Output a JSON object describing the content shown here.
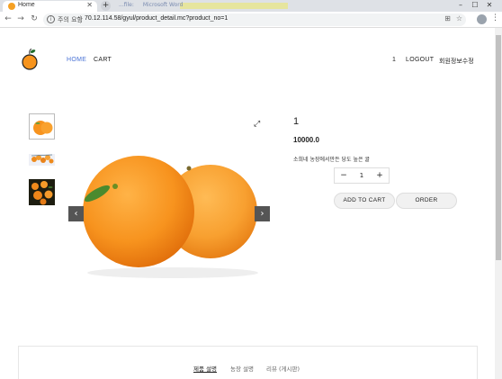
{
  "browser": {
    "tab_title": "Home",
    "blurred_tabs": [
      "...file:",
      "Microsoft Word"
    ],
    "security_label": "주의 요함",
    "url": "70.12.114.58/gyul/product_detail.mc?product_no=1"
  },
  "header": {
    "nav": [
      {
        "label": "HOME",
        "active": true
      },
      {
        "label": "CART",
        "active": false
      }
    ],
    "cart_count": "1",
    "logout_label": "LOGOUT",
    "member_edit_label": "회원정보수정"
  },
  "product": {
    "name": "1",
    "price": "10000.0",
    "description": "소희네 농장에서만든 당도 높은 귤",
    "quantity": "1",
    "add_to_cart_label": "ADD TO CART",
    "order_label": "ORDER"
  },
  "detail_tabs": [
    {
      "label": "제품 설명",
      "active": true
    },
    {
      "label": "농장 설명",
      "active": false
    },
    {
      "label": "리뷰 (게시판)",
      "active": false
    }
  ],
  "colors": {
    "accent": "#4a73d6",
    "button_bg": "#f1f1f1",
    "orange": "#f7941d"
  }
}
